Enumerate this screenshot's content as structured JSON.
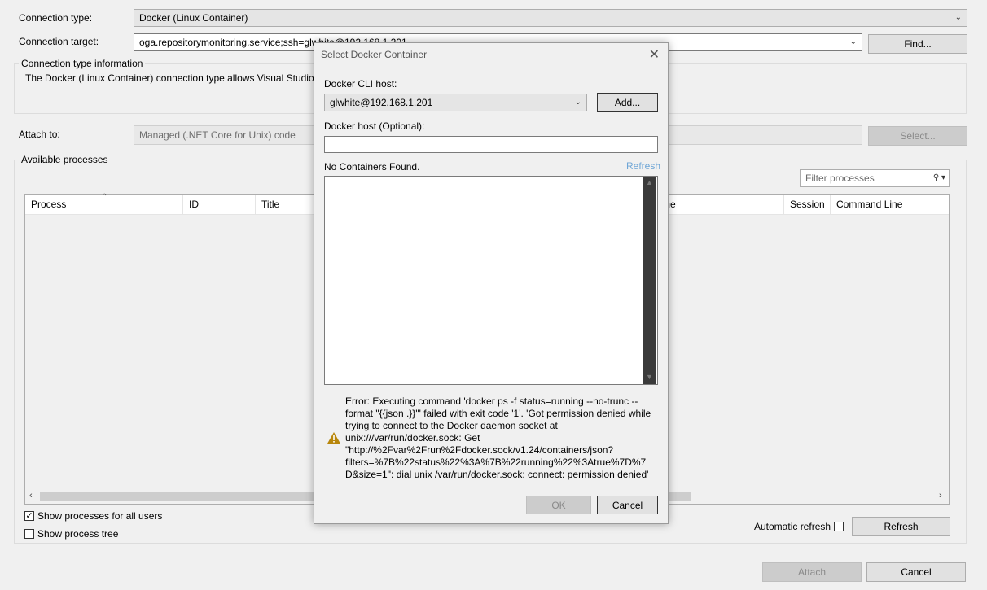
{
  "connection": {
    "type_label": "Connection type:",
    "type_value": "Docker (Linux Container)",
    "target_label": "Connection target:",
    "target_value": "oga.repositorymonitoring.service;ssh=glwhite@192.168.1.201",
    "find_button": "Find..."
  },
  "info": {
    "title": "Connection type information",
    "text": "The Docker (Linux Container) connection type allows Visual Studio t"
  },
  "attach": {
    "label": "Attach to:",
    "value": "Managed (.NET Core for Unix) code",
    "select_button": "Select..."
  },
  "processes": {
    "title": "Available processes",
    "filter_placeholder": "Filter processes",
    "columns": [
      "Process",
      "ID",
      "Title",
      "me",
      "Session",
      "Command Line"
    ],
    "show_all_users": "Show processes for all users",
    "show_tree": "Show process tree",
    "auto_refresh": "Automatic refresh",
    "refresh_button": "Refresh"
  },
  "footer": {
    "attach_button": "Attach",
    "cancel_button": "Cancel"
  },
  "dialog": {
    "title": "Select Docker Container",
    "cli_host_label": "Docker CLI host:",
    "cli_host_value": "glwhite@192.168.1.201",
    "add_button": "Add...",
    "docker_host_label": "Docker host (Optional):",
    "docker_host_value": "",
    "no_containers": "No Containers Found.",
    "refresh_link": "Refresh",
    "error": "Error: Executing command 'docker  ps -f status=running --no-trunc --format \"{{json .}}\"' failed with exit code '1'. 'Got permission denied while trying to connect to the Docker daemon socket at unix:///var/run/docker.sock: Get \"http://%2Fvar%2Frun%2Fdocker.sock/v1.24/containers/json?filters=%7B%22status%22%3A%7B%22running%22%3Atrue%7D%7D&size=1\": dial unix /var/run/docker.sock: connect: permission denied'",
    "ok_button": "OK",
    "cancel_button": "Cancel"
  }
}
